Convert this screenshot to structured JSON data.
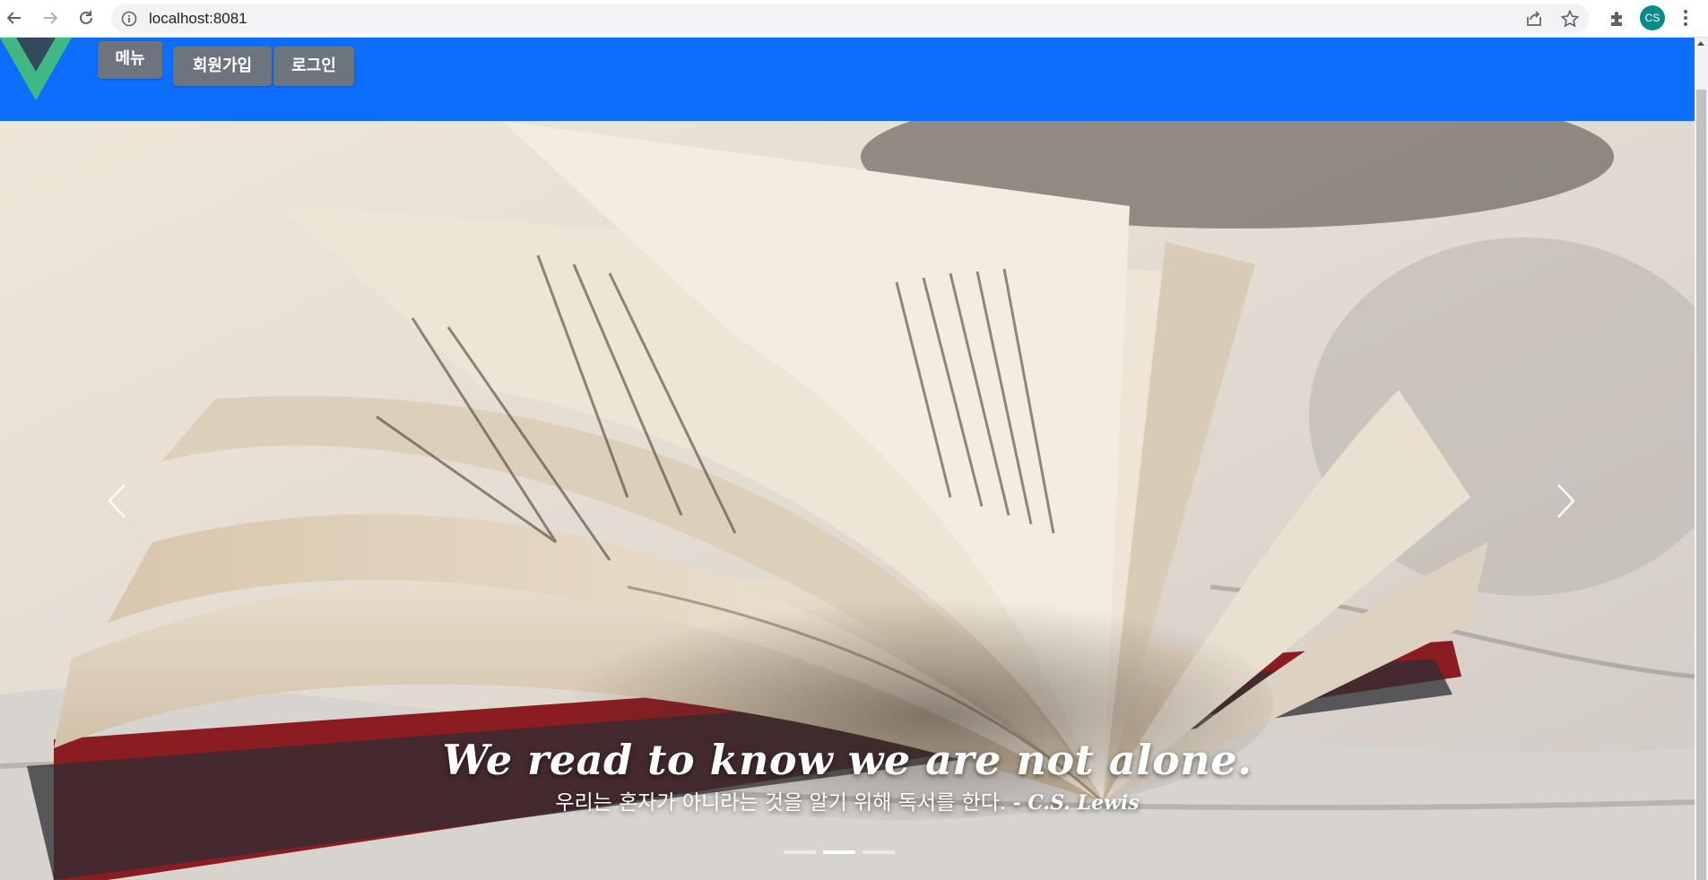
{
  "browser": {
    "url": "localhost:8081",
    "profile_initials": "CS",
    "icons": {
      "back": "back-arrow-icon",
      "forward": "forward-arrow-icon",
      "reload": "reload-icon",
      "info": "info-icon",
      "share": "share-icon",
      "bookmark": "star-icon",
      "extensions": "puzzle-icon",
      "menu": "kebab-icon"
    }
  },
  "navbar": {
    "brand_color": "#0d6efd",
    "menu_label": "메뉴",
    "signup_label": "회원가입",
    "login_label": "로그인"
  },
  "carousel": {
    "caption_title": "We read to know we are not alone.",
    "caption_sub": "우리는 혼자가 아니라는 것을 알기 위해 독서를 한다.",
    "caption_author": "- C.S. Lewis",
    "slide_count": 3,
    "active_index": 1,
    "image": "open-book-photo"
  }
}
